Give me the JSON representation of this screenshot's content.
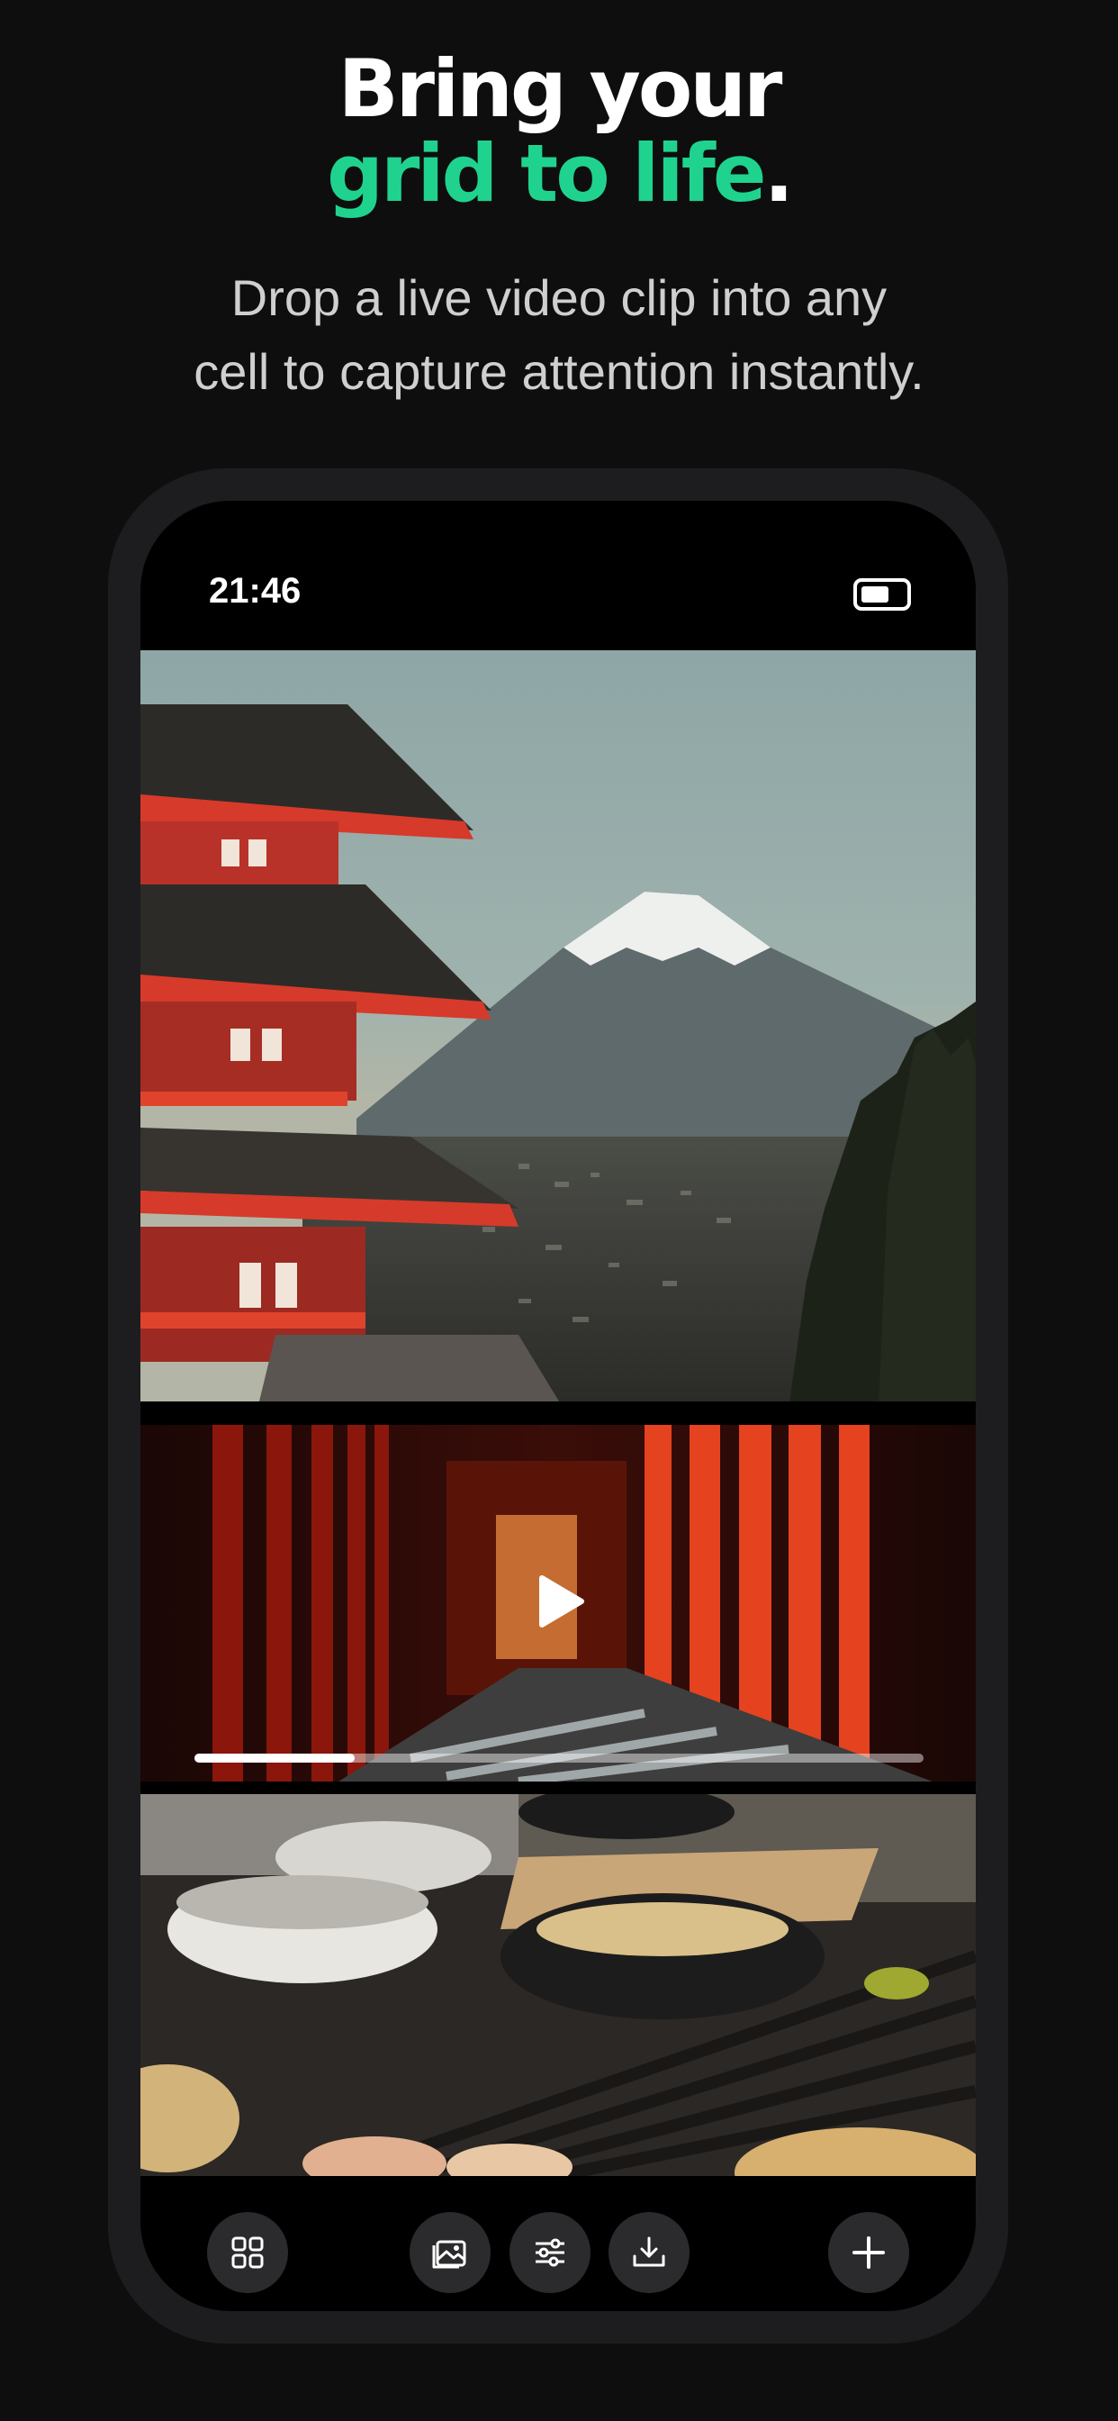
{
  "headline": {
    "line1": "Bring your",
    "line2_accent": "grid to life",
    "line2_period": "."
  },
  "subtitle": {
    "line1": "Drop a live video clip into any",
    "line2": "cell to capture attention instantly."
  },
  "status_bar": {
    "time": "21:46"
  },
  "video": {
    "progress_fraction": 0.22
  },
  "colors": {
    "accent": "#1fd38f",
    "background": "#0e0e0e",
    "phone_frame": "#1d1d1f"
  },
  "icons": {
    "toolbar": [
      "grid-icon",
      "image-icon",
      "sliders-icon",
      "download-icon",
      "plus-icon"
    ],
    "video": "play-icon",
    "status": "battery-icon"
  }
}
